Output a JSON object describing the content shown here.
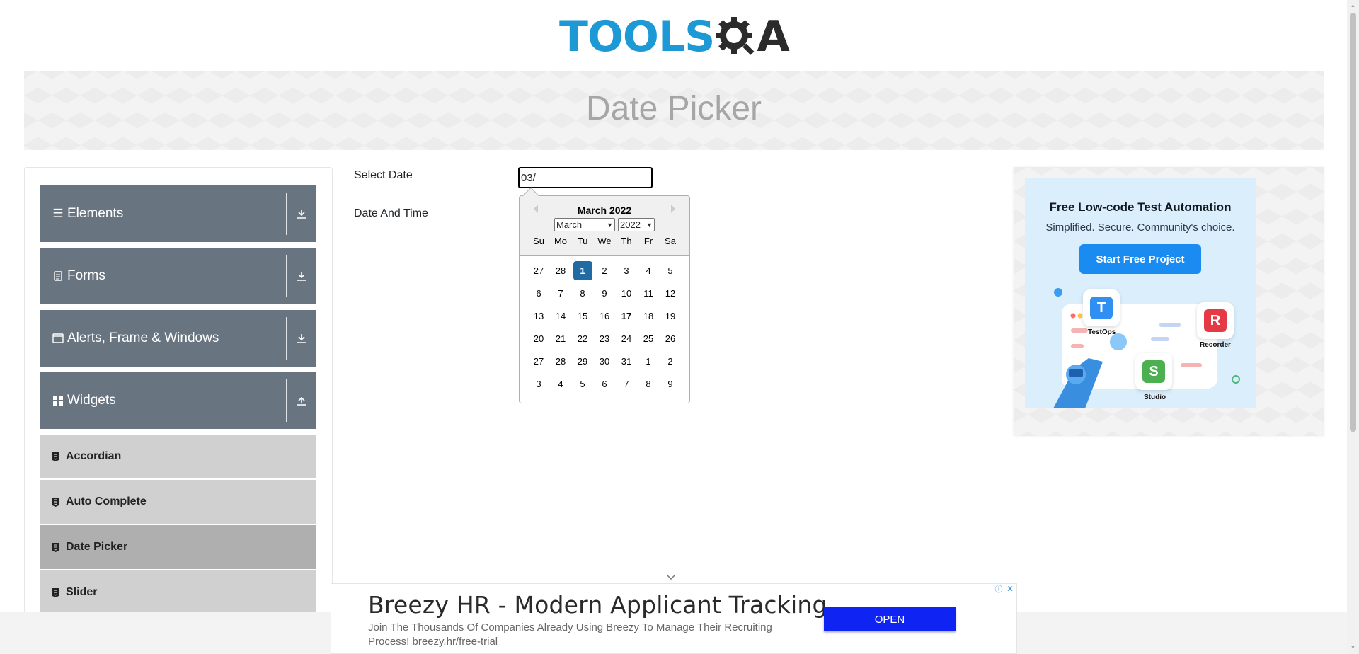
{
  "logo": {
    "text_tools": "TOOLS",
    "text_qa": "A",
    "alt": "ToolsQA logo"
  },
  "banner": {
    "title": "Date Picker"
  },
  "sidebar": {
    "groups": [
      {
        "label": "Elements",
        "icon": "hamburger-icon",
        "arrow": "download-arrow-icon"
      },
      {
        "label": "Forms",
        "icon": "document-icon",
        "arrow": "download-arrow-icon"
      },
      {
        "label": "Alerts, Frame & Windows",
        "icon": "window-icon",
        "arrow": "download-arrow-icon"
      },
      {
        "label": "Widgets",
        "icon": "grid-icon",
        "arrow": "upload-arrow-icon"
      }
    ],
    "items": [
      {
        "label": "Accordian",
        "active": false
      },
      {
        "label": "Auto Complete",
        "active": false
      },
      {
        "label": "Date Picker",
        "active": true
      },
      {
        "label": "Slider",
        "active": false
      }
    ]
  },
  "form": {
    "select_date_label": "Select Date",
    "date_time_label": "Date And Time",
    "date_input_value": "03/"
  },
  "datepicker": {
    "month_year": "March 2022",
    "month_select": "March",
    "year_select": "2022",
    "weekdays": [
      "Su",
      "Mo",
      "Tu",
      "We",
      "Th",
      "Fr",
      "Sa"
    ],
    "weeks": [
      [
        "27",
        "28",
        "1",
        "2",
        "3",
        "4",
        "5"
      ],
      [
        "6",
        "7",
        "8",
        "9",
        "10",
        "11",
        "12"
      ],
      [
        "13",
        "14",
        "15",
        "16",
        "17",
        "18",
        "19"
      ],
      [
        "20",
        "21",
        "22",
        "23",
        "24",
        "25",
        "26"
      ],
      [
        "27",
        "28",
        "29",
        "30",
        "31",
        "1",
        "2"
      ],
      [
        "3",
        "4",
        "5",
        "6",
        "7",
        "8",
        "9"
      ]
    ],
    "selected_day": "1",
    "today_day": "17"
  },
  "ad_right": {
    "title": "Free Low-code Test Automation",
    "subtitle": "Simplified. Secure. Community's choice.",
    "cta": "Start Free Project",
    "apps": [
      "TestOps",
      "Recorder",
      "Studio"
    ]
  },
  "bottom_ad": {
    "headline": "Breezy HR - Modern Applicant Tracking",
    "description": "Join The Thousands Of Companies Already Using Breezy To Manage Their Recruiting Process! breezy.hr/free-trial",
    "button": "OPEN"
  },
  "colors": {
    "brand_blue": "#1d9ad6",
    "sidebar_header": "#687480",
    "selected_day": "#216ba5",
    "ad_open_button": "#0f24f3"
  }
}
